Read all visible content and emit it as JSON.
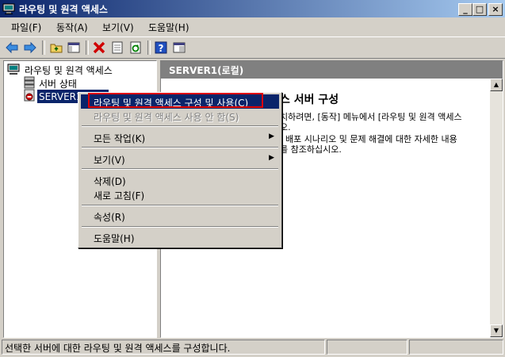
{
  "window": {
    "title": "라우팅 및 원격 액세스",
    "controls": {
      "minimize": "_",
      "maximize": "□",
      "close": "×"
    }
  },
  "menu": {
    "items": [
      "파일(F)",
      "동작(A)",
      "보기(V)",
      "도움말(H)"
    ]
  },
  "toolbar": {
    "icons": [
      "back-icon",
      "forward-icon",
      "up-folder-icon",
      "show-tree-icon",
      "delete-icon",
      "properties-icon",
      "refresh-icon",
      "help-icon",
      "console-icon"
    ]
  },
  "tree": {
    "root": "라우팅 및 원격 액세스",
    "server_status": "서버 상태",
    "server": "SERVER1(로컬)"
  },
  "right_pane": {
    "header": "SERVER1(로컬)",
    "title": "스 서버 구성",
    "line1": "치하려면, [동작] 메뉴에서 [라우팅 및 원격 액세스",
    "line2": "오.",
    "line3": ", 배포 시나리오 및 문제 해결에 대한 자세한 내용",
    "line4": "를 참조하십시오."
  },
  "context_menu": {
    "configure": "라우팅 및 원격 액세스 구성 및 사용(C)",
    "disable": "라우팅 및 원격 액세스 사용 안 함(S)",
    "all_tasks": "모든 작업(K)",
    "view": "보기(V)",
    "delete": "삭제(D)",
    "refresh": "새로 고침(F)",
    "properties": "속성(R)",
    "help": "도움말(H)",
    "submenu_arrow": "▶"
  },
  "statusbar": {
    "text": "선택한 서버에 대한 라우팅 및 원격 액세스를 구성합니다."
  },
  "colors": {
    "titlebar_start": "#0a246a",
    "titlebar_end": "#a6caf0",
    "highlight": "#0a246a",
    "annotation_box": "#e00000",
    "face": "#d4d0c8"
  }
}
